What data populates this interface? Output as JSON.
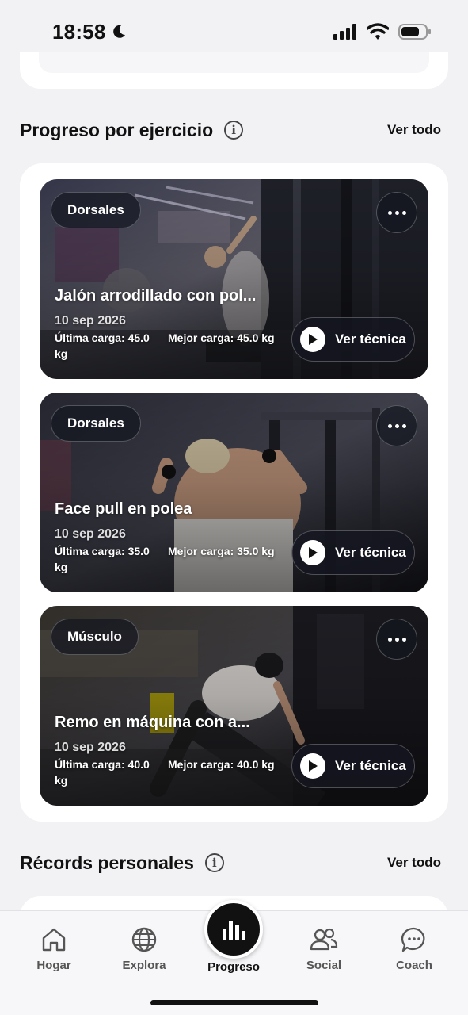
{
  "status_bar": {
    "time": "18:58"
  },
  "progress_section": {
    "title": "Progreso por ejercicio",
    "see_all": "Ver todo",
    "exercises": [
      {
        "tag": "Dorsales",
        "title": "Jalón arrodillado con pol...",
        "date": "10 sep 2026",
        "last_load": "Última carga: 45.0 kg",
        "best_load": "Mejor carga: 45.0 kg",
        "technique_label": "Ver técnica"
      },
      {
        "tag": "Dorsales",
        "title": "Face pull en polea",
        "date": "10 sep 2026",
        "last_load": "Última carga: 35.0 kg",
        "best_load": "Mejor carga: 35.0 kg",
        "technique_label": "Ver técnica"
      },
      {
        "tag": "Músculo",
        "title": "Remo en máquina con a...",
        "date": "10 sep 2026",
        "last_load": "Última carga: 40.0 kg",
        "best_load": "Mejor carga: 40.0 kg",
        "technique_label": "Ver técnica"
      }
    ]
  },
  "records_section": {
    "title": "Récords personales",
    "see_all": "Ver todo"
  },
  "bottom_nav": {
    "items": [
      {
        "label": "Hogar",
        "icon": "home-icon"
      },
      {
        "label": "Explora",
        "icon": "globe-icon"
      },
      {
        "label": "Progreso",
        "icon": "bar-chart-icon",
        "active": true
      },
      {
        "label": "Social",
        "icon": "people-icon"
      },
      {
        "label": "Coach",
        "icon": "chat-icon"
      }
    ]
  }
}
